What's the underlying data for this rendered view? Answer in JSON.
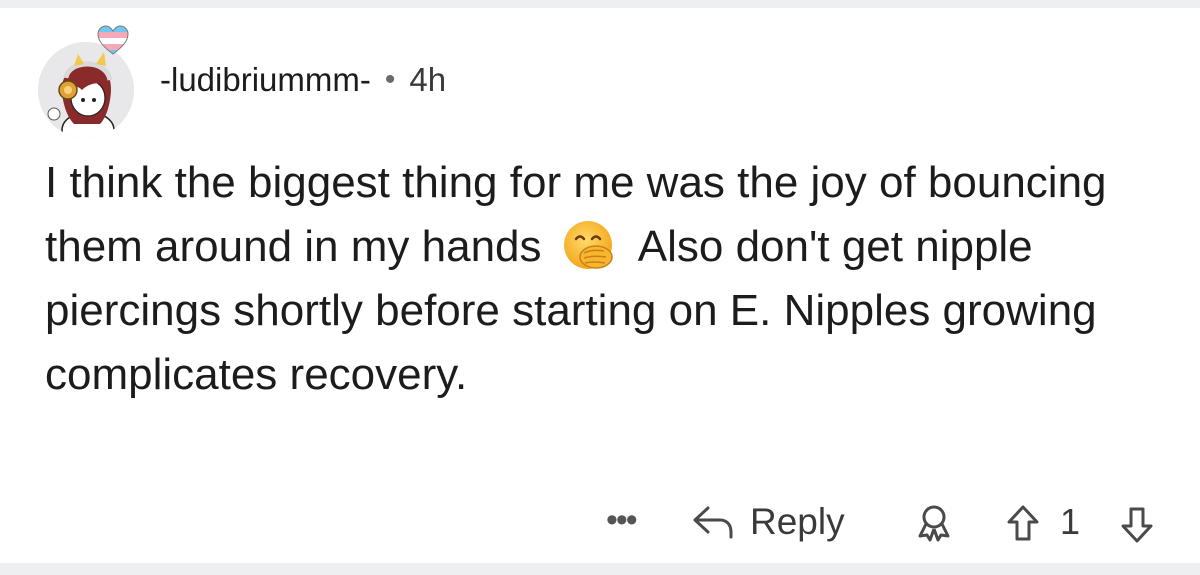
{
  "comment": {
    "author": "-ludibriummm-",
    "separator": "•",
    "age": "4h",
    "text_part1": "I think the biggest thing for me was the joy of bouncing them around in my hands",
    "emoji": "face-with-hand-over-mouth-emoji",
    "text_part2": "Also don't get nipple piercings shortly before starting on E. Nipples growing complicates recovery."
  },
  "actions": {
    "more_label": "•••",
    "reply_label": "Reply",
    "score": "1"
  },
  "colors": {
    "background": "#ffffff",
    "separator_band": "#edeff1",
    "text": "#1c1c1c",
    "meta_text": "#3a3a3a",
    "icon": "#4a4a4a"
  },
  "icons": [
    "trans-heart-flair-icon",
    "avatar",
    "reply-arrow-icon",
    "award-icon",
    "upvote-arrow-icon",
    "downvote-arrow-icon"
  ]
}
